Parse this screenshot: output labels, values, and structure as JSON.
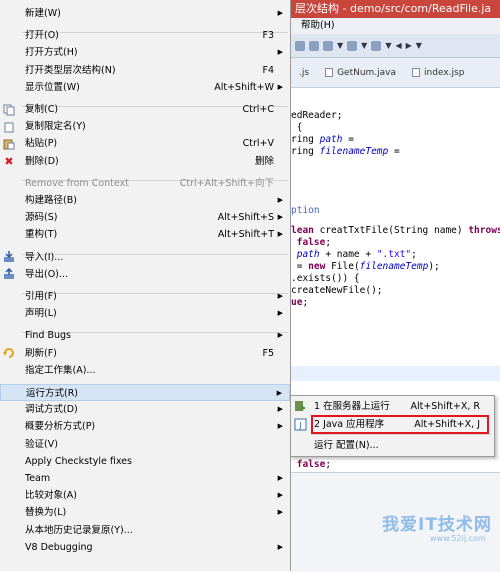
{
  "window": {
    "title": "层次结构 - demo/src/com/ReadFile.ja",
    "menubar": [
      "帮助(H)"
    ]
  },
  "editor_tabs": [
    {
      "label": ".js"
    },
    {
      "label": "GetNum.java"
    },
    {
      "label": "index.jsp"
    }
  ],
  "code_lines": [
    {
      "parts": [
        {
          "t": "edReader;",
          "c": ""
        }
      ]
    },
    {
      "parts": [
        {
          "t": " {",
          "c": ""
        }
      ]
    },
    {
      "parts": [
        {
          "t": "ring ",
          "c": ""
        },
        {
          "t": "path",
          "c": "it"
        },
        {
          "t": " =",
          "c": ""
        }
      ]
    },
    {
      "parts": [
        {
          "t": "ring ",
          "c": ""
        },
        {
          "t": "filenameTemp",
          "c": "it"
        },
        {
          "t": " =",
          "c": ""
        }
      ]
    },
    {
      "parts": [
        {
          "t": "ption",
          "c": "cm"
        }
      ]
    },
    {
      "parts": [
        {
          "t": "lean",
          "c": "kw"
        },
        {
          "t": " creatTxtFile(String name) ",
          "c": ""
        },
        {
          "t": "throws",
          "c": "kw"
        },
        {
          "t": " I",
          "c": ""
        }
      ]
    },
    {
      "parts": [
        {
          "t": " false",
          "c": "kw"
        },
        {
          "t": ";",
          "c": ""
        }
      ]
    },
    {
      "parts": [
        {
          "t": " path",
          "c": "it"
        },
        {
          "t": " + name + ",
          "c": ""
        },
        {
          "t": "\".txt\"",
          "c": "st"
        },
        {
          "t": ";",
          "c": ""
        }
      ]
    },
    {
      "parts": [
        {
          "t": " = ",
          "c": ""
        },
        {
          "t": "new",
          "c": "kw"
        },
        {
          "t": " File(",
          "c": ""
        },
        {
          "t": "filenameTemp",
          "c": "it"
        },
        {
          "t": ");",
          "c": ""
        }
      ]
    },
    {
      "parts": [
        {
          "t": ".exists()) {",
          "c": ""
        }
      ]
    },
    {
      "parts": [
        {
          "t": "createNewFile();",
          "c": ""
        }
      ]
    },
    {
      "parts": [
        {
          "t": "ue",
          "c": "kw"
        },
        {
          "t": ";",
          "c": ""
        }
      ]
    },
    {
      "parts": [
        {
          "t": " false",
          "c": "kw"
        },
        {
          "t": ";",
          "c": ""
        }
      ]
    }
  ],
  "context_menu": {
    "items": [
      {
        "label": "新建(W)",
        "accel": "",
        "submenu": true,
        "icon": "",
        "disabled": false,
        "active": false
      },
      {
        "sep": true
      },
      {
        "label": "打开(O)",
        "accel": "F3",
        "submenu": false,
        "icon": "",
        "disabled": false,
        "active": false
      },
      {
        "label": "打开方式(H)",
        "accel": "",
        "submenu": true,
        "icon": "",
        "disabled": false,
        "active": false
      },
      {
        "label": "打开类型层次结构(N)",
        "accel": "F4",
        "submenu": false,
        "icon": "",
        "disabled": false,
        "active": false
      },
      {
        "label": "显示位置(W)",
        "accel": "Alt+Shift+W",
        "submenu": true,
        "icon": "",
        "disabled": false,
        "active": false
      },
      {
        "sep": true
      },
      {
        "label": "复制(C)",
        "accel": "Ctrl+C",
        "submenu": false,
        "icon": "copy-icon",
        "disabled": false,
        "active": false
      },
      {
        "label": "复制限定名(Y)",
        "accel": "",
        "submenu": false,
        "icon": "copy-qualified-icon",
        "disabled": false,
        "active": false
      },
      {
        "label": "粘贴(P)",
        "accel": "Ctrl+V",
        "submenu": false,
        "icon": "paste-icon",
        "disabled": false,
        "active": false
      },
      {
        "label": "删除(D)",
        "accel": "删除",
        "submenu": false,
        "icon": "delete-icon",
        "disabled": false,
        "active": false
      },
      {
        "sep": true
      },
      {
        "label": "Remove from Context",
        "accel": "Ctrl+Alt+Shift+向下",
        "submenu": false,
        "icon": "",
        "disabled": true,
        "active": false
      },
      {
        "label": "构建路径(B)",
        "accel": "",
        "submenu": true,
        "icon": "",
        "disabled": false,
        "active": false
      },
      {
        "label": "源码(S)",
        "accel": "Alt+Shift+S",
        "submenu": true,
        "icon": "",
        "disabled": false,
        "active": false
      },
      {
        "label": "重构(T)",
        "accel": "Alt+Shift+T",
        "submenu": true,
        "icon": "",
        "disabled": false,
        "active": false
      },
      {
        "sep": true
      },
      {
        "label": "导入(I)...",
        "accel": "",
        "submenu": false,
        "icon": "import-icon",
        "disabled": false,
        "active": false
      },
      {
        "label": "导出(O)...",
        "accel": "",
        "submenu": false,
        "icon": "export-icon",
        "disabled": false,
        "active": false
      },
      {
        "sep": true
      },
      {
        "label": "引用(F)",
        "accel": "",
        "submenu": true,
        "icon": "",
        "disabled": false,
        "active": false
      },
      {
        "label": "声明(L)",
        "accel": "",
        "submenu": true,
        "icon": "",
        "disabled": false,
        "active": false
      },
      {
        "sep": true
      },
      {
        "label": "Find Bugs",
        "accel": "",
        "submenu": true,
        "icon": "",
        "disabled": false,
        "active": false
      },
      {
        "label": "刷新(F)",
        "accel": "F5",
        "submenu": false,
        "icon": "refresh-icon",
        "disabled": false,
        "active": false
      },
      {
        "label": "指定工作集(A)...",
        "accel": "",
        "submenu": false,
        "icon": "",
        "disabled": false,
        "active": false
      },
      {
        "sep": true
      },
      {
        "label": "运行方式(R)",
        "accel": "",
        "submenu": true,
        "icon": "",
        "disabled": false,
        "active": true
      },
      {
        "label": "调试方式(D)",
        "accel": "",
        "submenu": true,
        "icon": "",
        "disabled": false,
        "active": false
      },
      {
        "label": "概要分析方式(P)",
        "accel": "",
        "submenu": true,
        "icon": "",
        "disabled": false,
        "active": false
      },
      {
        "label": "验证(V)",
        "accel": "",
        "submenu": false,
        "icon": "",
        "disabled": false,
        "active": false
      },
      {
        "label": "Apply Checkstyle fixes",
        "accel": "",
        "submenu": false,
        "icon": "",
        "disabled": false,
        "active": false
      },
      {
        "label": "Team",
        "accel": "",
        "submenu": true,
        "icon": "",
        "disabled": false,
        "active": false
      },
      {
        "label": "比较对象(A)",
        "accel": "",
        "submenu": true,
        "icon": "",
        "disabled": false,
        "active": false
      },
      {
        "label": "替换为(L)",
        "accel": "",
        "submenu": true,
        "icon": "",
        "disabled": false,
        "active": false
      },
      {
        "label": "从本地历史记录复原(Y)...",
        "accel": "",
        "submenu": false,
        "icon": "",
        "disabled": false,
        "active": false
      },
      {
        "label": "V8 Debugging",
        "accel": "",
        "submenu": true,
        "icon": "",
        "disabled": false,
        "active": false
      }
    ]
  },
  "run_submenu": {
    "items": [
      {
        "label": "1 在服务器上运行",
        "accel": "Alt+Shift+X, R",
        "icon": "run-on-server-icon"
      },
      {
        "label": "2 Java 应用程序",
        "accel": "Alt+Shift+X, J",
        "icon": "java-app-icon"
      },
      {
        "label": "运行 配置(N)...",
        "accel": "",
        "icon": ""
      }
    ]
  },
  "watermark": {
    "logo": "我爱IT技术网",
    "url": "www.52ij.com"
  },
  "colors": {
    "highlight_box": "#e2141d",
    "active_item": "#d6e5f5",
    "title_bar": "#c8463c"
  }
}
